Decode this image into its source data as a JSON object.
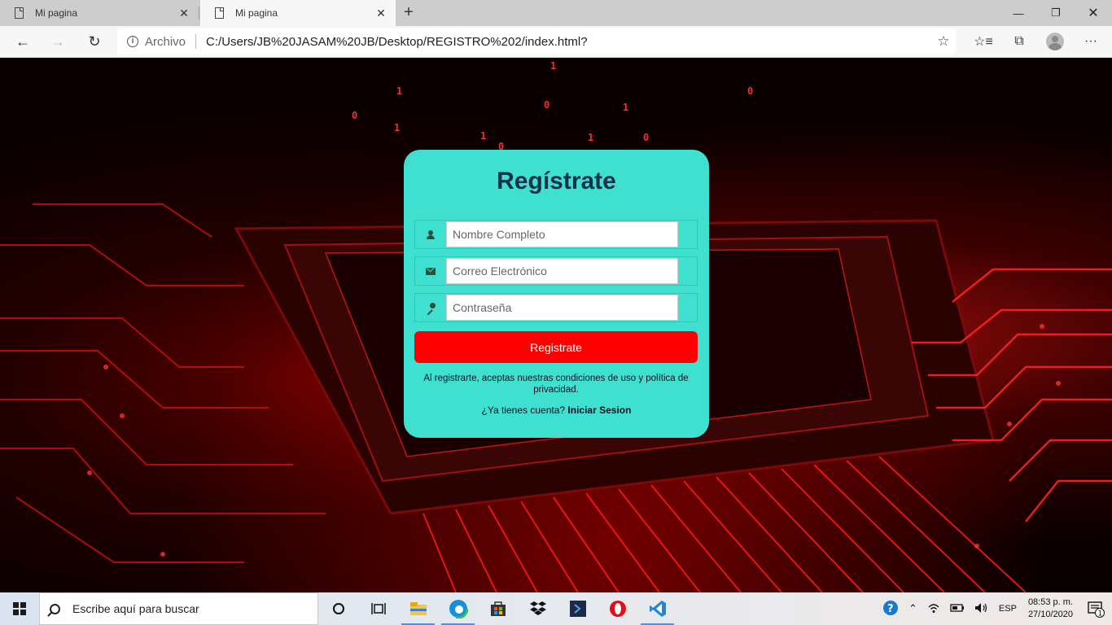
{
  "browser": {
    "tabs": [
      {
        "title": "Mi pagina",
        "active": false
      },
      {
        "title": "Mi pagina",
        "active": true
      }
    ],
    "address": {
      "scheme_label": "Archivo",
      "url": "C:/Users/JB%20JASAM%20JB/Desktop/REGISTRO%202/index.html?"
    }
  },
  "form": {
    "title": "Regístrate",
    "name_placeholder": "Nombre Completo",
    "email_placeholder": "Correo Electrónico",
    "password_placeholder": "Contraseña",
    "submit_label": "Registrate",
    "terms_text": "Al registrarte, aceptas nuestras condiciones de uso y política de privacidad.",
    "login_prompt": "¿Ya tienes cuenta?",
    "login_link": "Iniciar Sesion"
  },
  "taskbar": {
    "search_placeholder": "Escribe aquí para buscar",
    "language": "ESP",
    "time": "08:53 p. m.",
    "date": "27/10/2020",
    "notification_count": "1"
  },
  "colors": {
    "card_bg": "#40e0d0",
    "title_color": "#15304a",
    "submit_bg": "#ff0000"
  }
}
